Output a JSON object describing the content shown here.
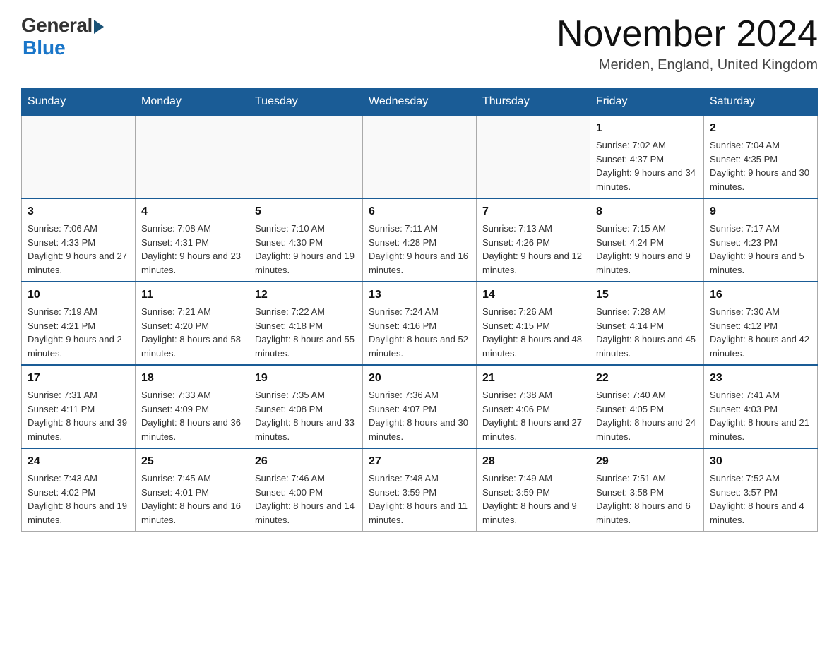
{
  "header": {
    "logo_general": "General",
    "logo_blue": "Blue",
    "month_title": "November 2024",
    "location": "Meriden, England, United Kingdom"
  },
  "days_of_week": [
    "Sunday",
    "Monday",
    "Tuesday",
    "Wednesday",
    "Thursday",
    "Friday",
    "Saturday"
  ],
  "weeks": [
    [
      {
        "day": "",
        "info": ""
      },
      {
        "day": "",
        "info": ""
      },
      {
        "day": "",
        "info": ""
      },
      {
        "day": "",
        "info": ""
      },
      {
        "day": "",
        "info": ""
      },
      {
        "day": "1",
        "info": "Sunrise: 7:02 AM\nSunset: 4:37 PM\nDaylight: 9 hours and 34 minutes."
      },
      {
        "day": "2",
        "info": "Sunrise: 7:04 AM\nSunset: 4:35 PM\nDaylight: 9 hours and 30 minutes."
      }
    ],
    [
      {
        "day": "3",
        "info": "Sunrise: 7:06 AM\nSunset: 4:33 PM\nDaylight: 9 hours and 27 minutes."
      },
      {
        "day": "4",
        "info": "Sunrise: 7:08 AM\nSunset: 4:31 PM\nDaylight: 9 hours and 23 minutes."
      },
      {
        "day": "5",
        "info": "Sunrise: 7:10 AM\nSunset: 4:30 PM\nDaylight: 9 hours and 19 minutes."
      },
      {
        "day": "6",
        "info": "Sunrise: 7:11 AM\nSunset: 4:28 PM\nDaylight: 9 hours and 16 minutes."
      },
      {
        "day": "7",
        "info": "Sunrise: 7:13 AM\nSunset: 4:26 PM\nDaylight: 9 hours and 12 minutes."
      },
      {
        "day": "8",
        "info": "Sunrise: 7:15 AM\nSunset: 4:24 PM\nDaylight: 9 hours and 9 minutes."
      },
      {
        "day": "9",
        "info": "Sunrise: 7:17 AM\nSunset: 4:23 PM\nDaylight: 9 hours and 5 minutes."
      }
    ],
    [
      {
        "day": "10",
        "info": "Sunrise: 7:19 AM\nSunset: 4:21 PM\nDaylight: 9 hours and 2 minutes."
      },
      {
        "day": "11",
        "info": "Sunrise: 7:21 AM\nSunset: 4:20 PM\nDaylight: 8 hours and 58 minutes."
      },
      {
        "day": "12",
        "info": "Sunrise: 7:22 AM\nSunset: 4:18 PM\nDaylight: 8 hours and 55 minutes."
      },
      {
        "day": "13",
        "info": "Sunrise: 7:24 AM\nSunset: 4:16 PM\nDaylight: 8 hours and 52 minutes."
      },
      {
        "day": "14",
        "info": "Sunrise: 7:26 AM\nSunset: 4:15 PM\nDaylight: 8 hours and 48 minutes."
      },
      {
        "day": "15",
        "info": "Sunrise: 7:28 AM\nSunset: 4:14 PM\nDaylight: 8 hours and 45 minutes."
      },
      {
        "day": "16",
        "info": "Sunrise: 7:30 AM\nSunset: 4:12 PM\nDaylight: 8 hours and 42 minutes."
      }
    ],
    [
      {
        "day": "17",
        "info": "Sunrise: 7:31 AM\nSunset: 4:11 PM\nDaylight: 8 hours and 39 minutes."
      },
      {
        "day": "18",
        "info": "Sunrise: 7:33 AM\nSunset: 4:09 PM\nDaylight: 8 hours and 36 minutes."
      },
      {
        "day": "19",
        "info": "Sunrise: 7:35 AM\nSunset: 4:08 PM\nDaylight: 8 hours and 33 minutes."
      },
      {
        "day": "20",
        "info": "Sunrise: 7:36 AM\nSunset: 4:07 PM\nDaylight: 8 hours and 30 minutes."
      },
      {
        "day": "21",
        "info": "Sunrise: 7:38 AM\nSunset: 4:06 PM\nDaylight: 8 hours and 27 minutes."
      },
      {
        "day": "22",
        "info": "Sunrise: 7:40 AM\nSunset: 4:05 PM\nDaylight: 8 hours and 24 minutes."
      },
      {
        "day": "23",
        "info": "Sunrise: 7:41 AM\nSunset: 4:03 PM\nDaylight: 8 hours and 21 minutes."
      }
    ],
    [
      {
        "day": "24",
        "info": "Sunrise: 7:43 AM\nSunset: 4:02 PM\nDaylight: 8 hours and 19 minutes."
      },
      {
        "day": "25",
        "info": "Sunrise: 7:45 AM\nSunset: 4:01 PM\nDaylight: 8 hours and 16 minutes."
      },
      {
        "day": "26",
        "info": "Sunrise: 7:46 AM\nSunset: 4:00 PM\nDaylight: 8 hours and 14 minutes."
      },
      {
        "day": "27",
        "info": "Sunrise: 7:48 AM\nSunset: 3:59 PM\nDaylight: 8 hours and 11 minutes."
      },
      {
        "day": "28",
        "info": "Sunrise: 7:49 AM\nSunset: 3:59 PM\nDaylight: 8 hours and 9 minutes."
      },
      {
        "day": "29",
        "info": "Sunrise: 7:51 AM\nSunset: 3:58 PM\nDaylight: 8 hours and 6 minutes."
      },
      {
        "day": "30",
        "info": "Sunrise: 7:52 AM\nSunset: 3:57 PM\nDaylight: 8 hours and 4 minutes."
      }
    ]
  ]
}
